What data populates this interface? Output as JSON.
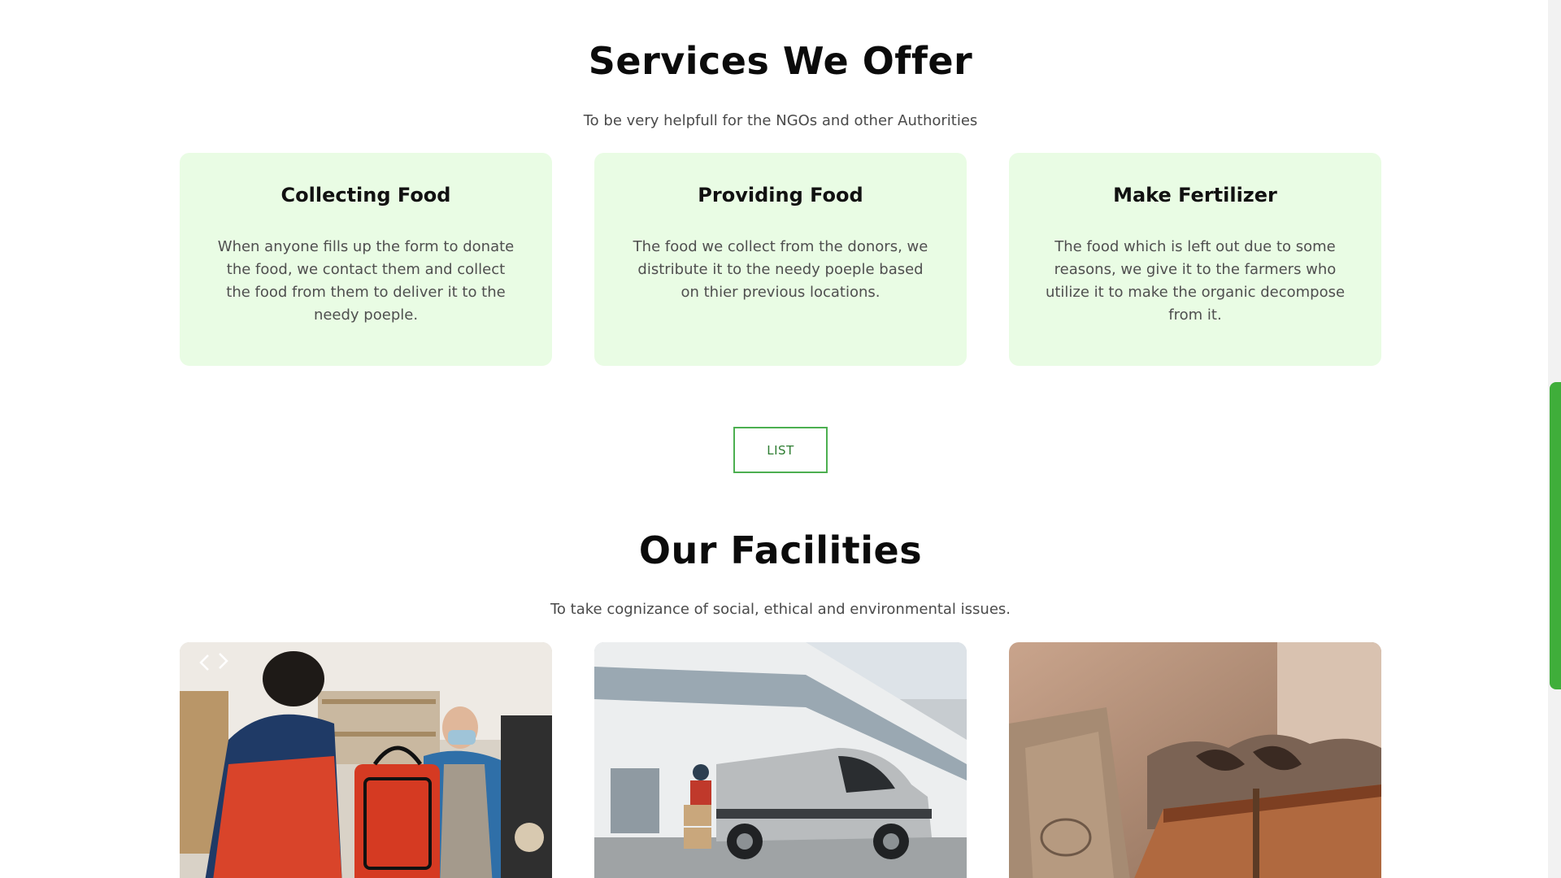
{
  "services": {
    "title": "Services We Offer",
    "subtitle": "To be very helpfull for the NGOs and other Authorities",
    "cards": [
      {
        "title": "Collecting Food",
        "text": "When anyone fills up the form to donate the food, we contact them and collect the food from them to deliver it to the needy poeple."
      },
      {
        "title": "Providing Food",
        "text": "The food we collect from the donors, we distribute it to the needy poeple based on thier previous locations."
      },
      {
        "title": "Make Fertilizer",
        "text": "The food which is left out due to some reasons, we give it to the farmers who utilize it to make the organic decompose from it."
      }
    ],
    "list_button": "LIST"
  },
  "facilities": {
    "title": "Our Facilities",
    "subtitle": "To take cognizance of social, ethical and environmental issues.",
    "images": [
      {
        "icon": "food-delivery-handoff-photo"
      },
      {
        "icon": "delivery-van-photo"
      },
      {
        "icon": "compost-crate-photo"
      }
    ]
  },
  "colors": {
    "card_background": "#e9fce4",
    "accent_green": "#4caf50",
    "scrollbar_thumb": "#3fae3a"
  }
}
